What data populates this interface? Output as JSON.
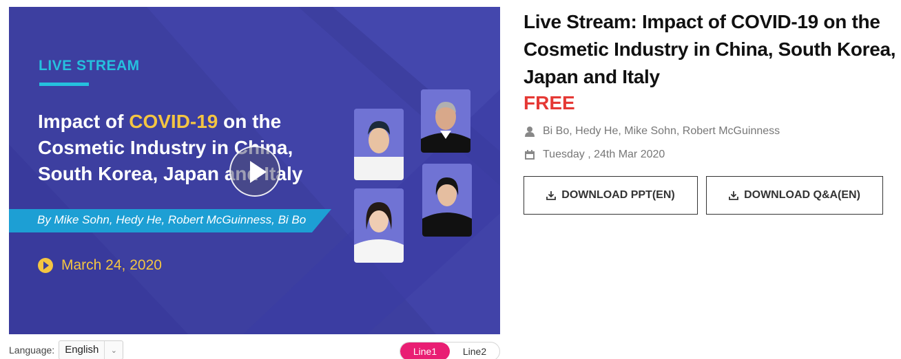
{
  "player": {
    "live_label": "LIVE STREAM",
    "title_pre": "Impact of ",
    "title_highlight": "COVID-19",
    "title_post": " on the Cosmetic Industry in China, South Korea, Japan and Italy",
    "by_line": "By Mike Sohn, Hedy He, Robert McGuinness, Bi Bo",
    "date": "March 24, 2020",
    "play_icon": "play-icon",
    "speakers": [
      "Speaker 1",
      "Speaker 2",
      "Speaker 3",
      "Speaker 4"
    ]
  },
  "language": {
    "label": "Language:",
    "selected": "English"
  },
  "lines": {
    "options": [
      "Line1",
      "Line2"
    ],
    "active": "Line1"
  },
  "info": {
    "title": "Live Stream: Impact of COVID-19 on the Cosmetic Industry in China, South Korea, Japan and Italy",
    "price": "FREE",
    "speakers": "Bi Bo, Hedy He, Mike Sohn, Robert McGuinness",
    "date": "Tuesday , 24th Mar 2020",
    "download_ppt": "DOWNLOAD PPT(EN)",
    "download_qa": "DOWNLOAD Q&A(EN)"
  },
  "colors": {
    "player_bg": "#3d3fa0",
    "accent_cyan": "#25c0de",
    "highlight_yellow": "#f4c542",
    "banner_blue": "#1d9fd4",
    "price_red": "#e53935",
    "line_active": "#e91e73"
  }
}
